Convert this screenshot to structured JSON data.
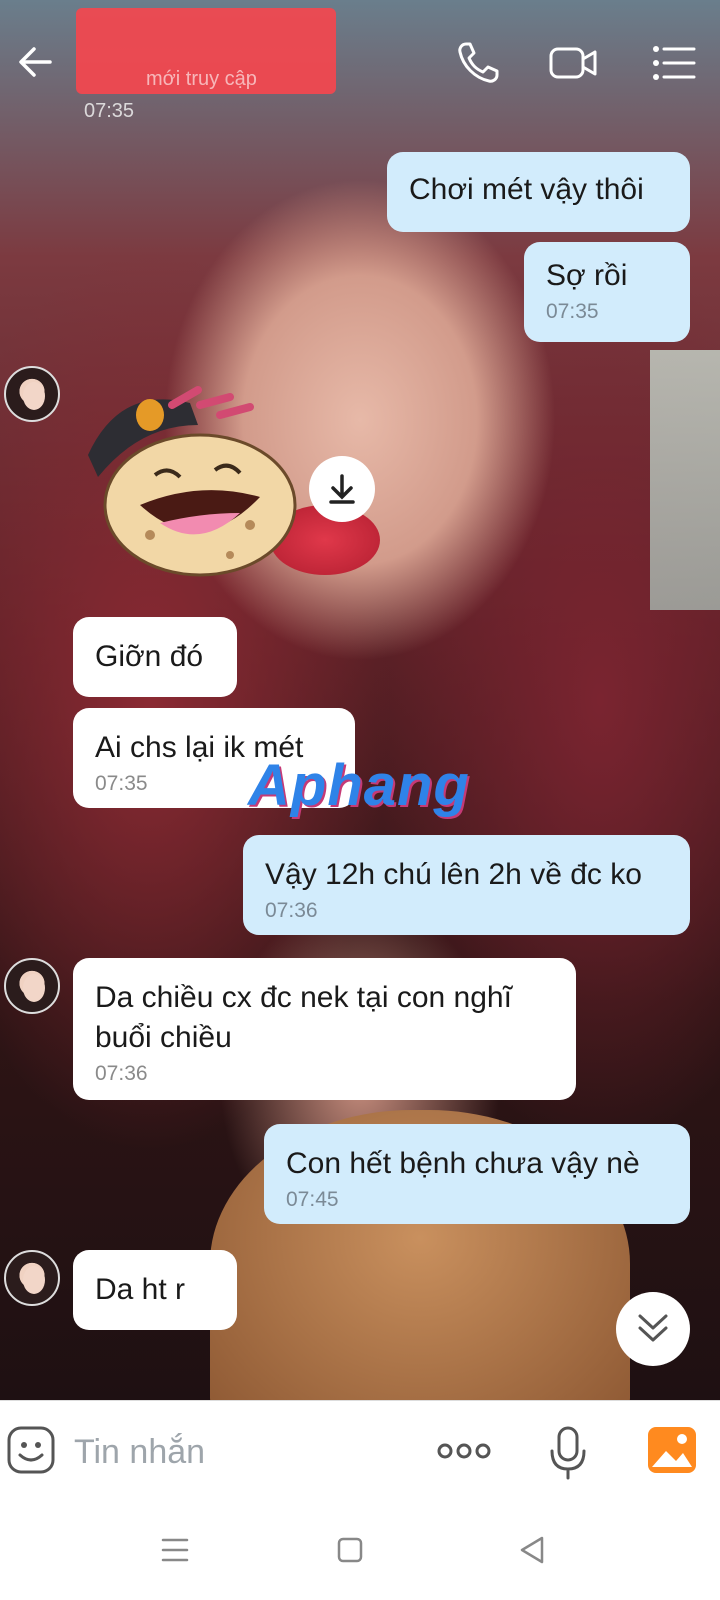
{
  "header": {
    "contact_name": "",
    "status": "mới truy cập"
  },
  "messages": [
    {
      "id": "m0",
      "dir": "in",
      "time": "07:35",
      "text": ""
    },
    {
      "id": "m1",
      "dir": "out",
      "text": "Chơi mét vậy thôi",
      "time": ""
    },
    {
      "id": "m2",
      "dir": "out",
      "text": "Sợ rồi",
      "time": "07:35"
    },
    {
      "id": "m3",
      "dir": "in",
      "text": "Giỡn đó",
      "time": ""
    },
    {
      "id": "m4",
      "dir": "in",
      "text": "Ai chs lại ik mét",
      "time": "07:35"
    },
    {
      "id": "m5",
      "dir": "out",
      "text": "Vậy 12h chú lên 2h về đc ko",
      "time": "07:36"
    },
    {
      "id": "m6",
      "dir": "in",
      "text": "Da chiều cx đc nek tại con nghĩ buổi chiều",
      "time": "07:36"
    },
    {
      "id": "m7",
      "dir": "out",
      "text": "Con hết bệnh chưa vậy nè",
      "time": "07:45"
    },
    {
      "id": "m8",
      "dir": "in",
      "text": "Da ht r",
      "time": ""
    }
  ],
  "watermark": "Aphang",
  "composer": {
    "placeholder": "Tin nhắn",
    "value": ""
  },
  "icons": {
    "back": "arrow-left-icon",
    "call": "phone-icon",
    "video": "video-camera-icon",
    "menu": "list-menu-icon",
    "download": "download-icon",
    "scroll": "double-chevron-down-icon",
    "emoji": "sticker-face-icon",
    "more": "three-dots-icon",
    "mic": "microphone-icon",
    "photo": "image-gallery-icon"
  },
  "colors": {
    "outgoing_bubble": "#d2ecfc",
    "incoming_bubble": "#ffffff",
    "redaction": "#f4464e",
    "photo_icon": "#ff8a1f"
  }
}
